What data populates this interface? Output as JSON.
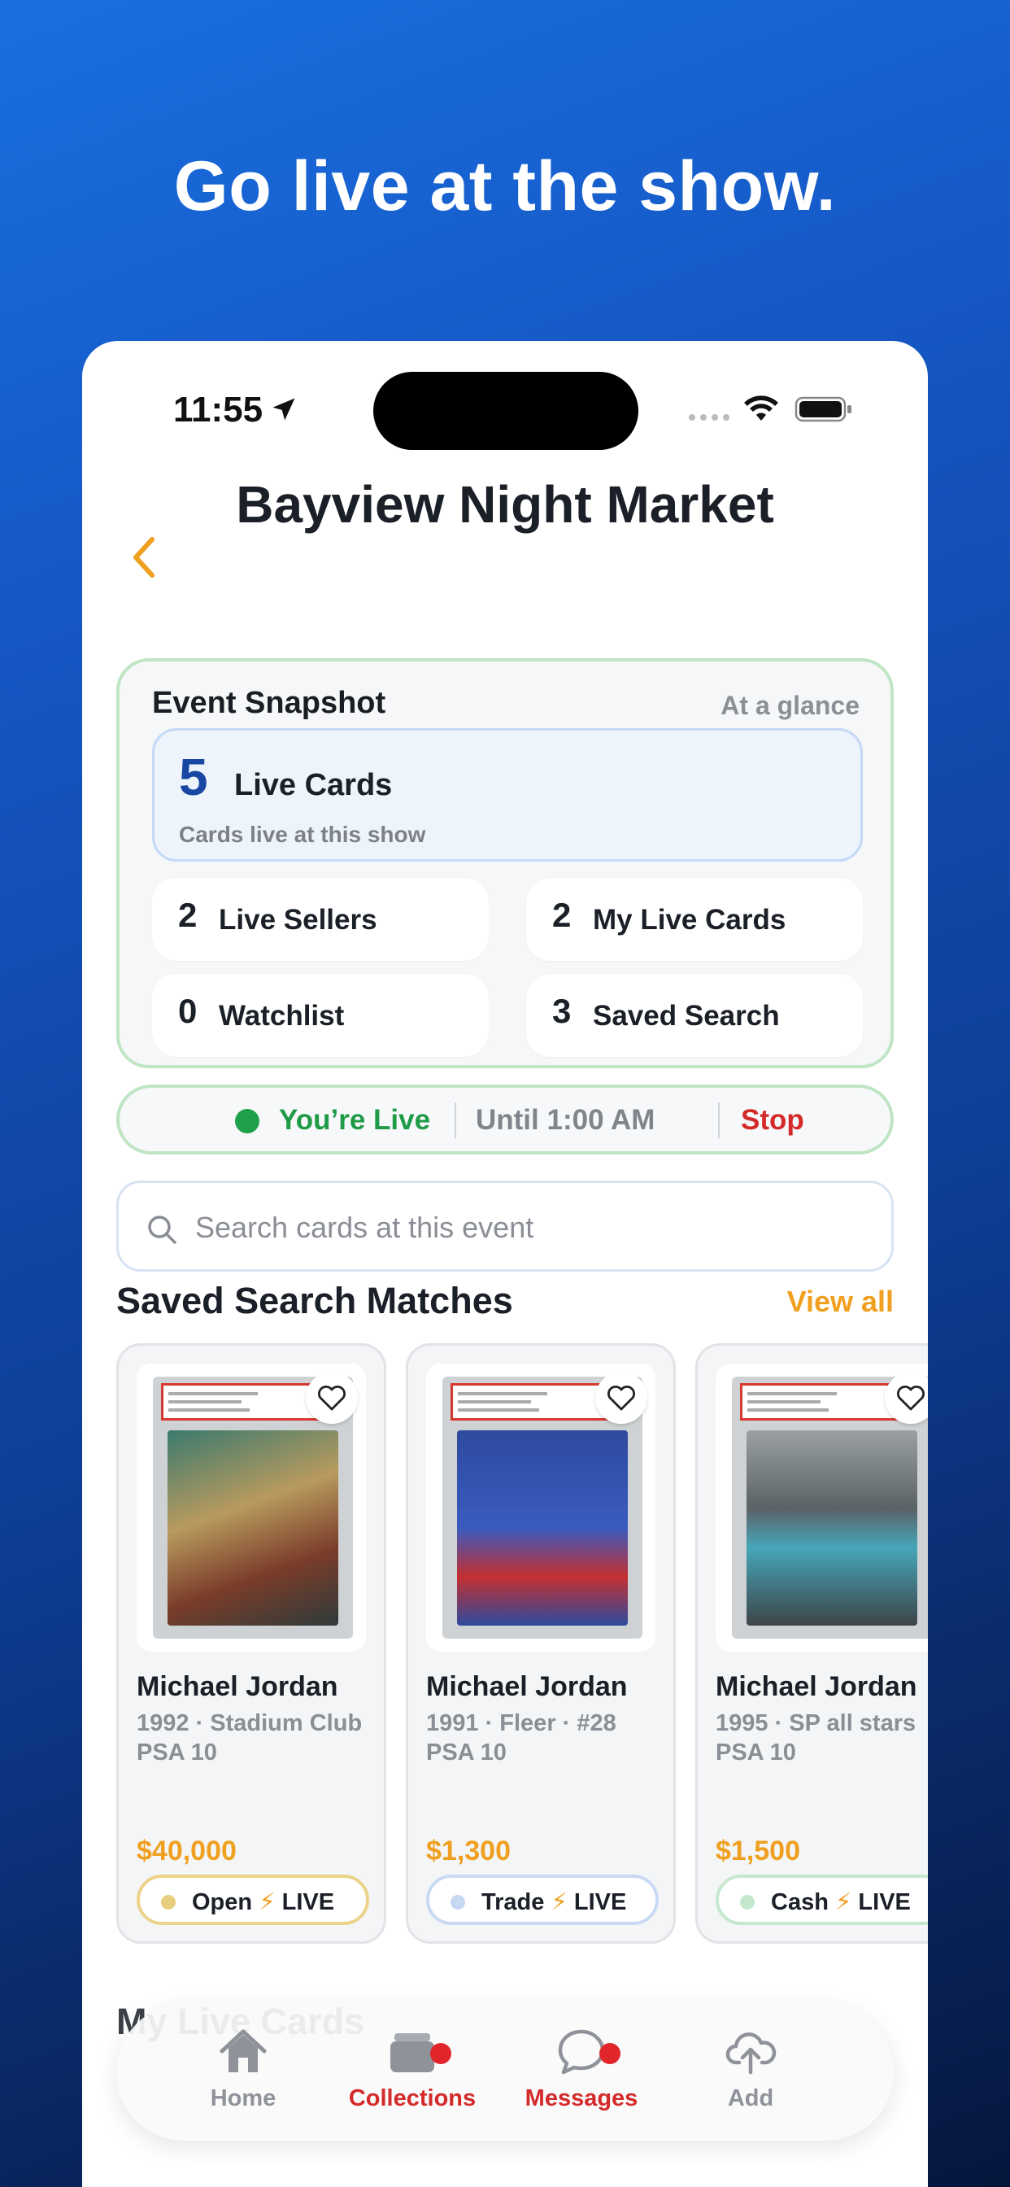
{
  "headline": "Go live at the show.",
  "status_bar": {
    "time": "11:55"
  },
  "header": {
    "title": "Bayview Night Market"
  },
  "snapshot": {
    "title": "Event Snapshot",
    "subtitle": "At a glance",
    "live_cards": {
      "count": "5",
      "label": "Live Cards",
      "description": "Cards live at this show"
    },
    "stats": [
      {
        "count": "2",
        "label": "Live Sellers"
      },
      {
        "count": "2",
        "label": "My Live Cards"
      },
      {
        "count": "0",
        "label": "Watchlist"
      },
      {
        "count": "3",
        "label": "Saved Search"
      }
    ]
  },
  "live_status": {
    "label": "You’re Live",
    "until": "Until 1:00 AM",
    "stop": "Stop"
  },
  "search": {
    "placeholder": "Search cards at this event"
  },
  "saved_matches": {
    "title": "Saved Search Matches",
    "view_all": "View all",
    "cards": [
      {
        "name": "Michael Jordan",
        "meta": "1992 · Stadium Club",
        "grade": "PSA 10",
        "price": "$40,000",
        "chip": "Open",
        "live": "LIVE",
        "chip_color": "#ecd38a",
        "dot_color": "#e8cf80"
      },
      {
        "name": "Michael Jordan",
        "meta": "1991 · Fleer · #28",
        "grade": "PSA 10",
        "price": "$1,300",
        "chip": "Trade",
        "live": "LIVE",
        "chip_color": "#c8daf3",
        "dot_color": "#c6d8f2"
      },
      {
        "name": "Michael Jordan",
        "meta": "1995 · SP all stars",
        "grade": "PSA 10",
        "price": "$1,500",
        "chip": "Cash",
        "live": "LIVE",
        "chip_color": "#c6e8cd",
        "dot_color": "#c4e8cb"
      }
    ]
  },
  "next_section": {
    "title": "My Live Cards"
  },
  "tabs": [
    {
      "label": "Home",
      "icon": "home-icon"
    },
    {
      "label": "Collections",
      "icon": "collections-icon"
    },
    {
      "label": "Messages",
      "icon": "messages-icon"
    },
    {
      "label": "Add",
      "icon": "cloud-upload-icon"
    }
  ],
  "colors": {
    "accent": "#f0a020",
    "live_green": "#1f9b47",
    "stop_red": "#d42a2a",
    "badge_red": "#e0262b",
    "live_blue": "#1847a3"
  }
}
